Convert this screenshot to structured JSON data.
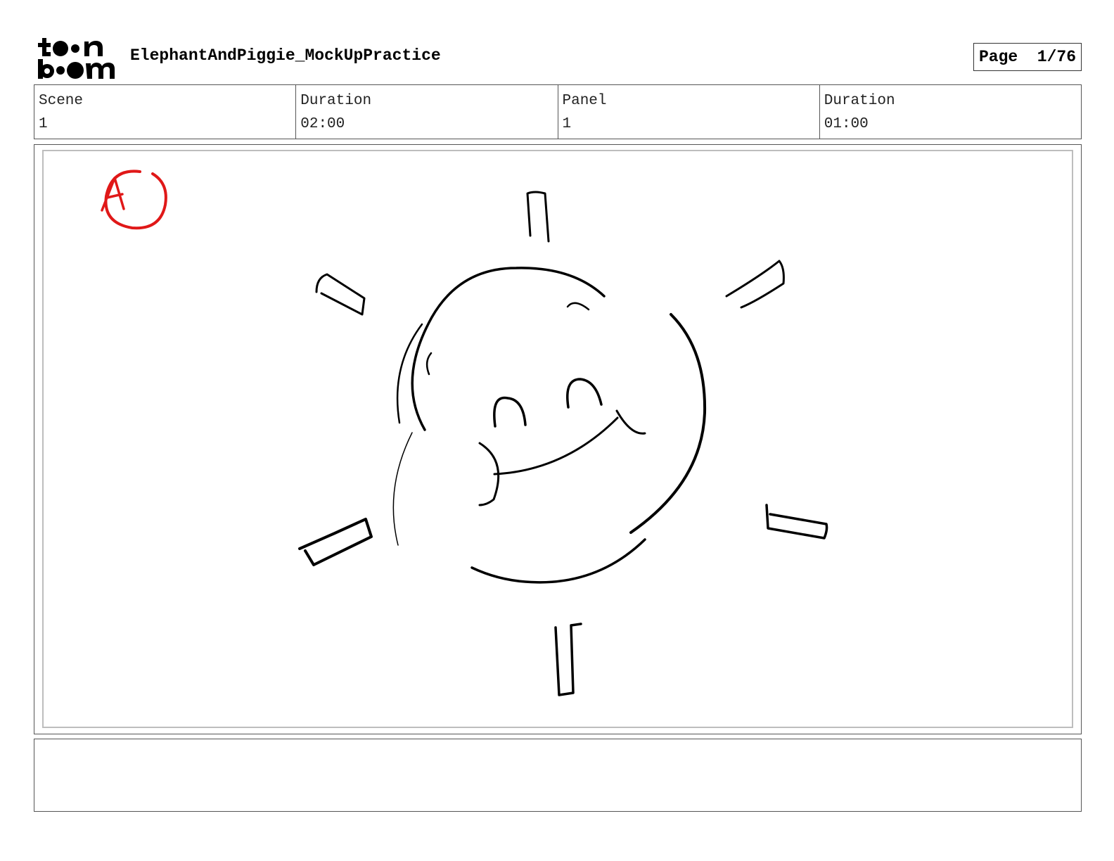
{
  "header": {
    "logo_text": "toon boom",
    "title": "ElephantAndPiggie_MockUpPractice",
    "page_label": "Page",
    "page_value": "1/76"
  },
  "info": [
    {
      "label": "Scene",
      "value": "1"
    },
    {
      "label": "Duration",
      "value": "02:00"
    },
    {
      "label": "Panel",
      "value": "1"
    },
    {
      "label": "Duration",
      "value": "01:00"
    }
  ],
  "panel": {
    "marker_letter": "A",
    "marker_color": "#e01818",
    "drawing": "smiling-sun-sketch"
  },
  "notes": {
    "text": ""
  }
}
